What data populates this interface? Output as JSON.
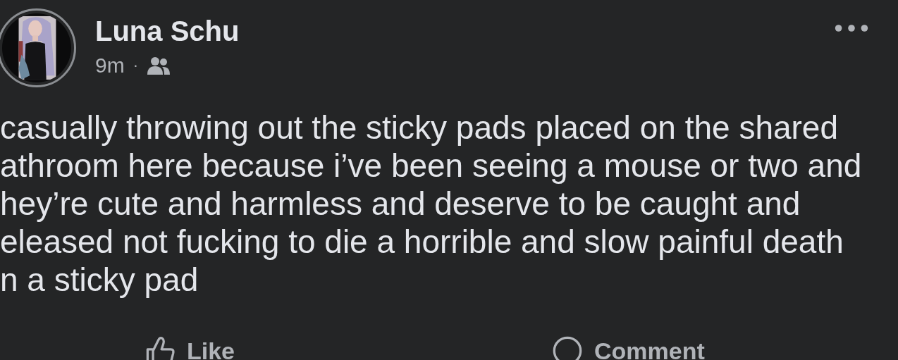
{
  "post": {
    "author": "Luna Schu",
    "time": "9m",
    "separator": "·",
    "text": "casually throwing out the sticky pads placed on the shared\nathroom here because i’ve been seeing a mouse or two and\nhey’re cute and harmless and deserve to be caught and\neleased not fucking to die a horrible and slow painful death\nn a sticky pad"
  },
  "actions": [
    {
      "kind": "like",
      "label": "Like"
    },
    {
      "kind": "comment",
      "label": "Comment"
    }
  ]
}
